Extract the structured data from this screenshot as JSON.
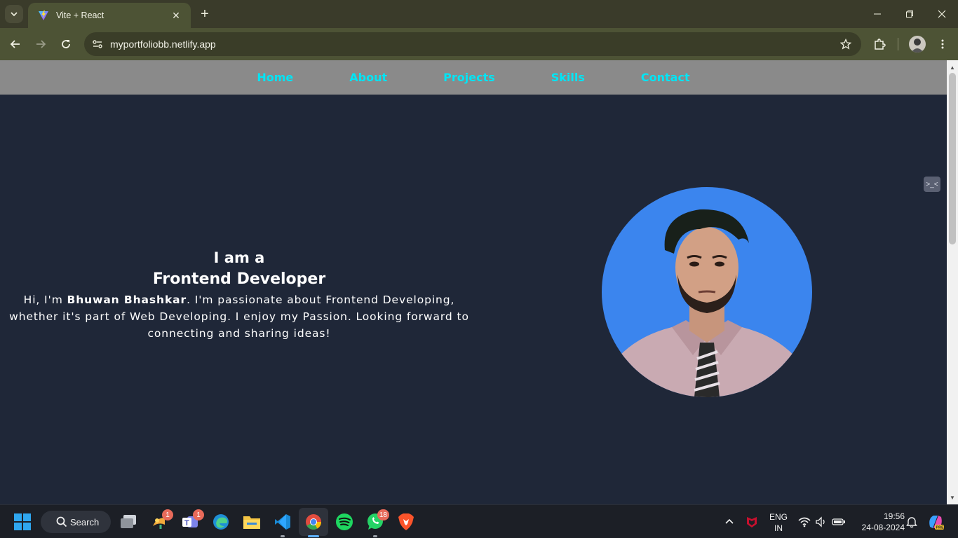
{
  "browser": {
    "tab_title": "Vite + React",
    "url": "myportfoliobb.netlify.app"
  },
  "nav": {
    "items": [
      "Home",
      "About",
      "Projects",
      "Skills",
      "Contact"
    ]
  },
  "hero": {
    "line1": "I am a",
    "line2": "Frontend Developer",
    "bio_prefix": "Hi, I'm ",
    "name": "Bhuwan Bhashkar",
    "bio_suffix": ". I'm passionate about Frontend Developing, whether it's part of Web Developing. I enjoy my Passion. Looking forward to connecting and sharing ideas!"
  },
  "ext_badge": ">_<",
  "taskbar": {
    "search_label": "Search",
    "badges": {
      "widgets": "1",
      "teams": "1",
      "whatsapp": "18"
    },
    "lang_line1": "ENG",
    "lang_line2": "IN",
    "time": "19:56",
    "date": "24-08-2024"
  },
  "colors": {
    "page_bg": "#1f2738",
    "navbar_bg": "#8a8a8a",
    "nav_link": "#00e5f5",
    "portrait_bg": "#3b85ee",
    "chrome_toolbar": "#4d5335"
  }
}
